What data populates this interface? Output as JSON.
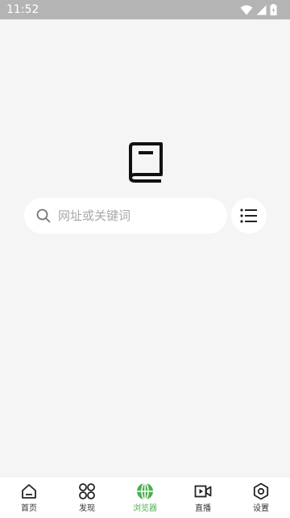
{
  "status_bar": {
    "time": "11:52"
  },
  "search": {
    "placeholder": "网址或关键词",
    "value": ""
  },
  "bottom_nav": {
    "items": [
      {
        "label": "首页",
        "icon": "home-icon",
        "active": false
      },
      {
        "label": "发现",
        "icon": "discover-icon",
        "active": false
      },
      {
        "label": "浏览器",
        "icon": "globe-icon",
        "active": true
      },
      {
        "label": "直播",
        "icon": "video-icon",
        "active": false
      },
      {
        "label": "设置",
        "icon": "settings-icon",
        "active": false
      }
    ]
  },
  "colors": {
    "accent": "#4caf50",
    "background": "#f5f5f5",
    "status_bar": "#b4b4b4",
    "icon": "#222222"
  }
}
